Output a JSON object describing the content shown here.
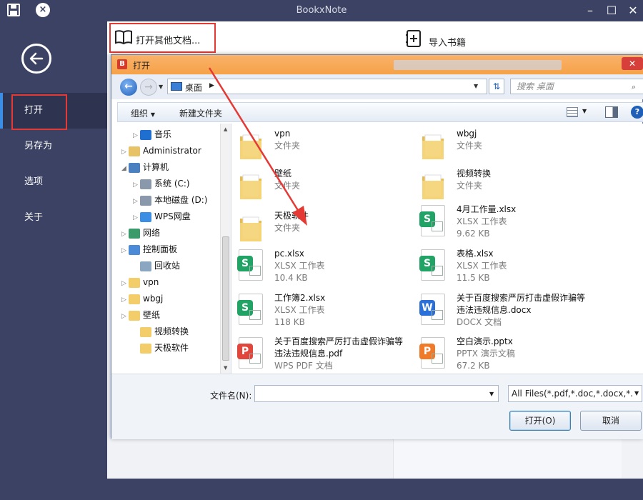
{
  "window": {
    "title": "BookxNote"
  },
  "sidebar": {
    "items": [
      {
        "label": "打开"
      },
      {
        "label": "另存为"
      },
      {
        "label": "选项"
      },
      {
        "label": "关于"
      }
    ]
  },
  "toolbar": {
    "open_other": "打开其他文档...",
    "import_books": "导入书籍"
  },
  "dialog": {
    "title": "打开",
    "breadcrumb": "桌面",
    "search_placeholder": "搜索 桌面",
    "organize": "组织",
    "new_folder": "新建文件夹",
    "nav": [
      {
        "label": "音乐",
        "icon": "music-icon"
      },
      {
        "label": "Administrator",
        "icon": "user-folder-icon"
      },
      {
        "label": "计算机",
        "icon": "computer-icon"
      },
      {
        "label": "系统 (C:)",
        "icon": "drive-icon"
      },
      {
        "label": "本地磁盘 (D:)",
        "icon": "drive-icon"
      },
      {
        "label": "WPS网盘",
        "icon": "cloud-icon"
      },
      {
        "label": "网络",
        "icon": "network-icon"
      },
      {
        "label": "控制面板",
        "icon": "control-panel-icon"
      },
      {
        "label": "回收站",
        "icon": "recycle-bin-icon"
      },
      {
        "label": "vpn",
        "icon": "folder-icon"
      },
      {
        "label": "wbgj",
        "icon": "folder-icon"
      },
      {
        "label": "壁纸",
        "icon": "folder-icon"
      },
      {
        "label": "视频转换",
        "icon": "folder-icon"
      },
      {
        "label": "天极软件",
        "icon": "folder-icon"
      }
    ],
    "files": [
      {
        "name": "vpn",
        "type": "文件夹",
        "size": "",
        "kind": "folder"
      },
      {
        "name": "wbgj",
        "type": "文件夹",
        "size": "",
        "kind": "folder"
      },
      {
        "name": "壁纸",
        "type": "文件夹",
        "size": "",
        "kind": "folder"
      },
      {
        "name": "视频转换",
        "type": "文件夹",
        "size": "",
        "kind": "folder"
      },
      {
        "name": "天极软件",
        "type": "文件夹",
        "size": "",
        "kind": "folder"
      },
      {
        "name": "4月工作量.xlsx",
        "type": "XLSX 工作表",
        "size": "9.62 KB",
        "kind": "xlsx"
      },
      {
        "name": "pc.xlsx",
        "type": "XLSX 工作表",
        "size": "10.4 KB",
        "kind": "xlsx"
      },
      {
        "name": "表格.xlsx",
        "type": "XLSX 工作表",
        "size": "11.5 KB",
        "kind": "xlsx"
      },
      {
        "name": "工作簿2.xlsx",
        "type": "XLSX 工作表",
        "size": "118 KB",
        "kind": "xlsx"
      },
      {
        "name": "关于百度搜索严厉打击虚假诈骗等违法违规信息.docx",
        "type": "DOCX 文档",
        "size": "",
        "kind": "docx"
      },
      {
        "name": "关于百度搜索严厉打击虚假诈骗等违法违规信息.pdf",
        "type": "WPS PDF 文档",
        "size": "",
        "kind": "pdf"
      },
      {
        "name": "空白演示.pptx",
        "type": "PPTX 演示文稿",
        "size": "67.2 KB",
        "kind": "pptx"
      }
    ],
    "filename_label": "文件名(N):",
    "filename_value": "",
    "filter": "All Files(*.pdf,*.doc,*.docx,*.x",
    "open_button": "打开(O)",
    "cancel_button": "取消"
  },
  "colors": {
    "sidebar": "#3c4263",
    "highlight": "#e53935",
    "accent": "#f6a248"
  }
}
